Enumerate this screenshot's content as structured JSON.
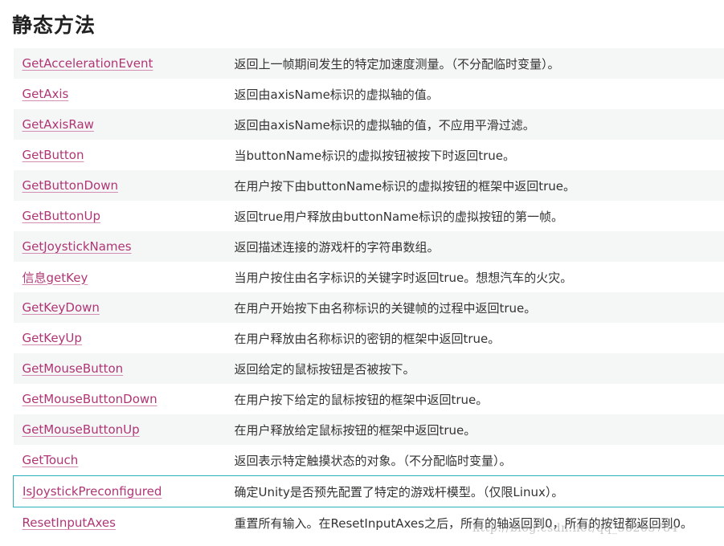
{
  "heading": "静态方法",
  "methods": [
    {
      "name": "GetAccelerationEvent",
      "description": "返回上一帧期间发生的特定加速度测量。（不分配临时变量）。"
    },
    {
      "name": "GetAxis",
      "description": "返回由axisName标识的虚拟轴的值。"
    },
    {
      "name": "GetAxisRaw",
      "description": "返回由axisName标识的虚拟轴的值，不应用平滑过滤。"
    },
    {
      "name": "GetButton",
      "description": "当buttonName标识的虚拟按钮被按下时返回true。"
    },
    {
      "name": "GetButtonDown",
      "description": "在用户按下由buttonName标识的虚拟按钮的框架中返回true。"
    },
    {
      "name": "GetButtonUp",
      "description": "返回true用户释放由buttonName标识的虚拟按钮的第一帧。"
    },
    {
      "name": "GetJoystickNames",
      "description": "返回描述连接的游戏杆的字符串数组。"
    },
    {
      "name": "信息getKey",
      "description": "当用户按住由名字标识的关键字时返回true。想想汽车的火灾。"
    },
    {
      "name": "GetKeyDown",
      "description": "在用户开始按下由名称标识的关键帧的过程中返回true。"
    },
    {
      "name": "GetKeyUp",
      "description": "在用户释放由名称标识的密钥的框架中返回true。"
    },
    {
      "name": "GetMouseButton",
      "description": "返回给定的鼠标按钮是否被按下。"
    },
    {
      "name": "GetMouseButtonDown",
      "description": "在用户按下给定的鼠标按钮的框架中返回true。"
    },
    {
      "name": "GetMouseButtonUp",
      "description": "在用户释放给定鼠标按钮的框架中返回true。"
    },
    {
      "name": "GetTouch",
      "description": "返回表示特定触摸状态的对象。（不分配临时变量）。"
    },
    {
      "name": "IsJoystickPreconfigured",
      "description": "确定Unity是否预先配置了特定的游戏杆模型。（仅限Linux）。"
    },
    {
      "name": "ResetInputAxes",
      "description": "重置所有输入。在ResetInputAxes之后，所有的轴返回到0，所有的按钮都返回到0。"
    }
  ],
  "selected_index": 14,
  "watermark": "http://blog.csdn.net/qq_38263784"
}
